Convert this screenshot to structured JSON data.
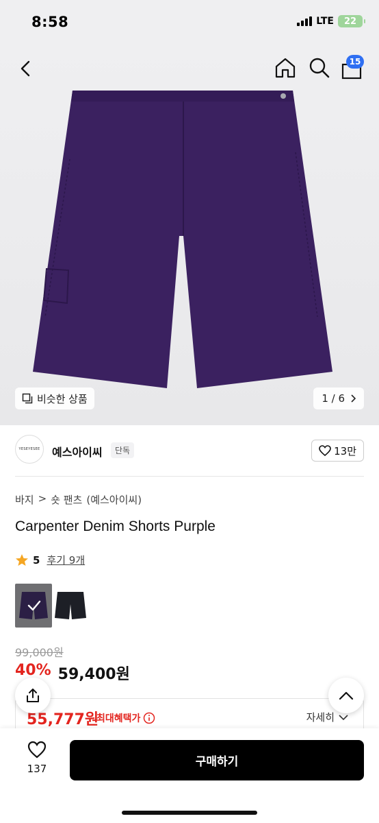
{
  "status": {
    "time": "8:58",
    "network": "LTE",
    "battery": "22"
  },
  "header": {
    "back_icon": "chevron-left-icon",
    "home_icon": "home-icon",
    "search_icon": "search-icon",
    "cart_icon": "shopping-bag-icon",
    "cart_count": "15"
  },
  "gallery": {
    "similar_label": "비슷한 상품",
    "page_indicator": "1 / 6",
    "product_color": "#3b2160"
  },
  "brand": {
    "logo_text": "YESEYESEE",
    "name": "예스아이씨",
    "tag": "단독",
    "likes": "13만"
  },
  "breadcrumb": [
    "바지",
    "숏 팬츠",
    "(예스아이씨)"
  ],
  "product": {
    "title": "Carpenter Denim Shorts Purple",
    "rating_score": "5",
    "reviews": "후기 9개",
    "original_price": "99,000원",
    "discount": "40%",
    "sale_price": "59,400원"
  },
  "swatches": [
    {
      "name": "Purple",
      "selected": true
    },
    {
      "name": "Black",
      "selected": false
    }
  ],
  "benefit": {
    "price": "55,777원",
    "label": "최대혜택가",
    "detail": "자세히"
  },
  "bottom_bar": {
    "like_count": "137",
    "buy_label": "구매하기"
  },
  "colors": {
    "accent_red": "#e3251f",
    "badge_blue": "#2f6ff2",
    "buy_button": "#000000"
  }
}
